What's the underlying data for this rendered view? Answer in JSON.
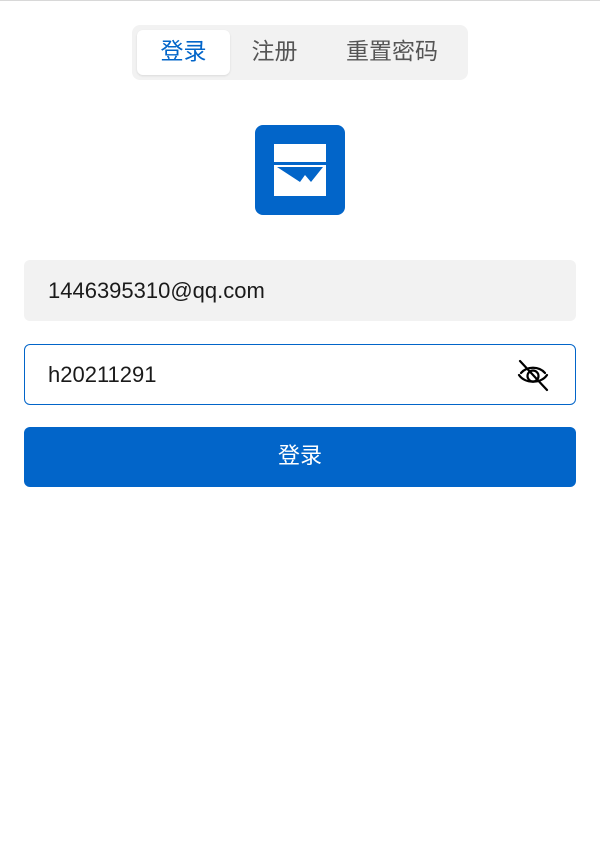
{
  "tabs": [
    {
      "label": "登录",
      "active": true
    },
    {
      "label": "注册",
      "active": false
    },
    {
      "label": "重置密码",
      "active": false
    }
  ],
  "logo": {
    "icon": "app-logo-icon",
    "color": "#0265c9"
  },
  "form": {
    "email_value": "1446395310@qq.com",
    "password_value": "h20211291",
    "password_toggle_icon": "eye-slash-icon",
    "submit_label": "登录"
  },
  "colors": {
    "accent": "#0265c9",
    "input_bg": "#f2f2f2",
    "text": "#1a1a1a",
    "tab_inactive_text": "#555555"
  }
}
